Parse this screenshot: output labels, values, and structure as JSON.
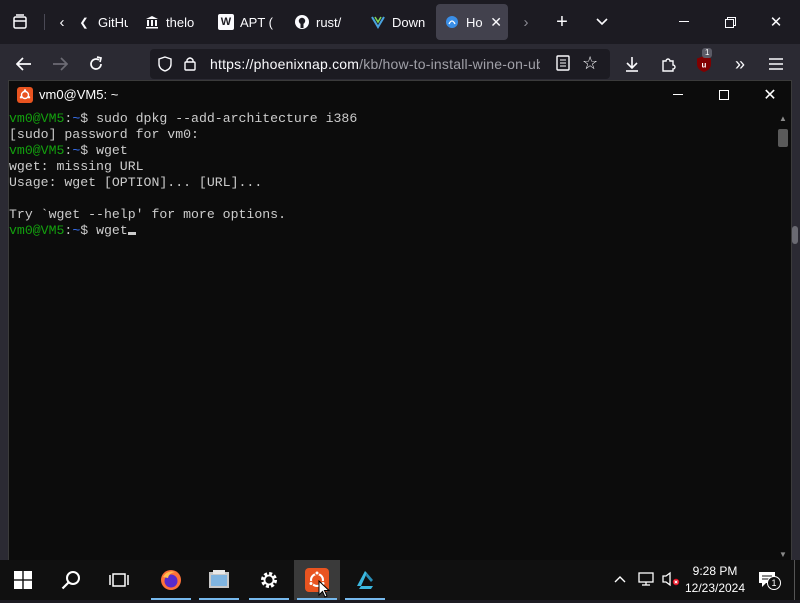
{
  "browser": {
    "tabs": [
      {
        "label": "GitHu",
        "favicon": "github-back-icon"
      },
      {
        "label": "thelo",
        "favicon": "library-icon"
      },
      {
        "label": "APT (",
        "favicon": "wikipedia-icon"
      },
      {
        "label": "rust/",
        "favicon": "github-icon"
      },
      {
        "label": "Down",
        "favicon": "download-site-icon"
      },
      {
        "label": "Ho",
        "favicon": "phoenixnap-icon",
        "active": true
      }
    ],
    "url": {
      "host": "https://phoenixnap.com",
      "path": "/kb/how-to-install-wine-on-ub"
    },
    "extension_badge": "1"
  },
  "terminal": {
    "title": "vm0@VM5: ~",
    "lines": [
      {
        "user": "vm0@VM5",
        "path": "~",
        "cmd": "sudo dpkg --add-architecture i386"
      },
      {
        "text": "[sudo] password for vm0:"
      },
      {
        "user": "vm0@VM5",
        "path": "~",
        "cmd": "wget"
      },
      {
        "text": "wget: missing URL"
      },
      {
        "text": "Usage: wget [OPTION]... [URL]..."
      },
      {
        "text": ""
      },
      {
        "text": "Try `wget --help' for more options."
      },
      {
        "user": "vm0@VM5",
        "path": "~",
        "cmd": "wget",
        "cursor": true
      }
    ]
  },
  "taskbar": {
    "time": "9:28 PM",
    "date": "12/23/2024",
    "notifications": "1",
    "apps": [
      "start-icon",
      "search-icon",
      "task-view-icon",
      "firefox-icon",
      "file-explorer-icon",
      "settings-icon",
      "ubuntu-icon",
      "app-icon"
    ]
  },
  "colors": {
    "prompt_user": "#13a10e",
    "prompt_path": "#3b78ff",
    "ubuntu": "#e95420",
    "taskbar_accent": "#76b9ed"
  }
}
